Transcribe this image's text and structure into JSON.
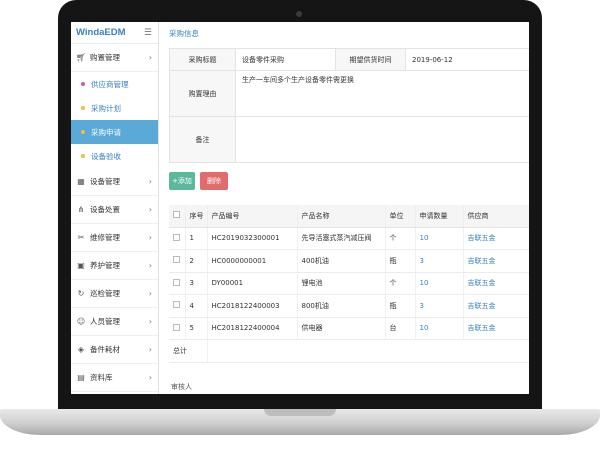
{
  "app": {
    "brand": "WindaEDM",
    "menu_icon": "hamburger-icon"
  },
  "sidebar": {
    "groups": [
      {
        "label": "购置管理",
        "icon": "cart-icon",
        "expanded": true
      },
      {
        "label": "设备管理",
        "icon": "grid-icon"
      },
      {
        "label": "设备处置",
        "icon": "share-icon"
      },
      {
        "label": "维修管理",
        "icon": "tools-icon"
      },
      {
        "label": "养护管理",
        "icon": "picture-icon"
      },
      {
        "label": "巡检管理",
        "icon": "refresh-icon"
      },
      {
        "label": "人员管理",
        "icon": "user-icon"
      },
      {
        "label": "备件耗材",
        "icon": "box-icon"
      },
      {
        "label": "资料库",
        "icon": "book-icon"
      }
    ],
    "subitems": [
      {
        "label": "供应商管理",
        "dot": "#e0569a"
      },
      {
        "label": "采购计划",
        "dot": "#f0c040"
      },
      {
        "label": "采购申请",
        "dot": "#f0c040",
        "active": true
      },
      {
        "label": "设备验收",
        "dot": "#f0c040"
      }
    ]
  },
  "main": {
    "section_title": "采购信息",
    "form": {
      "title_label": "采购标题",
      "title_value": "设备零件采购",
      "date_label": "期望供货时间",
      "date_value": "2019-06-12",
      "reason_label": "购置理由",
      "reason_value": "生产一车间多个生产设备零件需更换",
      "remark_label": "备注",
      "remark_value": ""
    },
    "buttons": {
      "add": "+添加",
      "delete": "删除"
    },
    "table": {
      "headers": [
        "序号",
        "产品编号",
        "产品名称",
        "单位",
        "申请数量",
        "供应商"
      ],
      "rows": [
        {
          "no": "1",
          "code": "HC2019032300001",
          "name": "先导活塞式蒸汽减压阀",
          "unit": "个",
          "qty": "10",
          "supplier": "吉联五金"
        },
        {
          "no": "2",
          "code": "HC0000000001",
          "name": "400机油",
          "unit": "瓶",
          "qty": "3",
          "supplier": "吉联五金"
        },
        {
          "no": "3",
          "code": "DY00001",
          "name": "锂电池",
          "unit": "个",
          "qty": "10",
          "supplier": "吉联五金"
        },
        {
          "no": "4",
          "code": "HC2018122400003",
          "name": "800机油",
          "unit": "瓶",
          "qty": "3",
          "supplier": "吉联五金"
        },
        {
          "no": "5",
          "code": "HC2018122400004",
          "name": "供电器",
          "unit": "台",
          "qty": "10",
          "supplier": "吉联五金"
        }
      ],
      "total_label": "总计"
    },
    "reviewer_label": "审核人"
  },
  "colors": {
    "accent": "#3b7fc4",
    "active_menu": "#5aa9d6",
    "add_button": "#5cb89a",
    "delete_button": "#e06c6c"
  }
}
